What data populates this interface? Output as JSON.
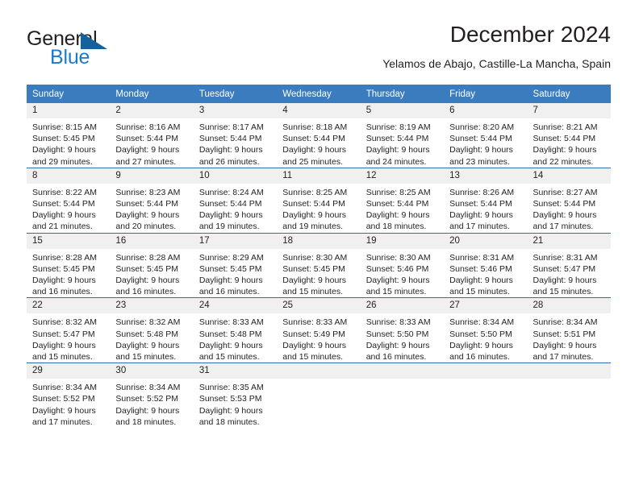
{
  "brand": {
    "line1": "General",
    "line2": "Blue",
    "flag_icon": "triangle-flag-icon",
    "blue_hex": "#1c7ac9",
    "dark_hex": "#15619e"
  },
  "header": {
    "title": "December 2024",
    "subtitle": "Yelamos de Abajo, Castille-La Mancha, Spain"
  },
  "theme": {
    "header_row_bg": "#3a7cbe",
    "daynum_bg": "#f0f0f0",
    "row_divider": "#2c6fb0"
  },
  "weekday_headers": [
    "Sunday",
    "Monday",
    "Tuesday",
    "Wednesday",
    "Thursday",
    "Friday",
    "Saturday"
  ],
  "weeks": [
    [
      {
        "day": "1",
        "sunrise": "Sunrise: 8:15 AM",
        "sunset": "Sunset: 5:45 PM",
        "daylight1": "Daylight: 9 hours",
        "daylight2": "and 29 minutes."
      },
      {
        "day": "2",
        "sunrise": "Sunrise: 8:16 AM",
        "sunset": "Sunset: 5:44 PM",
        "daylight1": "Daylight: 9 hours",
        "daylight2": "and 27 minutes."
      },
      {
        "day": "3",
        "sunrise": "Sunrise: 8:17 AM",
        "sunset": "Sunset: 5:44 PM",
        "daylight1": "Daylight: 9 hours",
        "daylight2": "and 26 minutes."
      },
      {
        "day": "4",
        "sunrise": "Sunrise: 8:18 AM",
        "sunset": "Sunset: 5:44 PM",
        "daylight1": "Daylight: 9 hours",
        "daylight2": "and 25 minutes."
      },
      {
        "day": "5",
        "sunrise": "Sunrise: 8:19 AM",
        "sunset": "Sunset: 5:44 PM",
        "daylight1": "Daylight: 9 hours",
        "daylight2": "and 24 minutes."
      },
      {
        "day": "6",
        "sunrise": "Sunrise: 8:20 AM",
        "sunset": "Sunset: 5:44 PM",
        "daylight1": "Daylight: 9 hours",
        "daylight2": "and 23 minutes."
      },
      {
        "day": "7",
        "sunrise": "Sunrise: 8:21 AM",
        "sunset": "Sunset: 5:44 PM",
        "daylight1": "Daylight: 9 hours",
        "daylight2": "and 22 minutes."
      }
    ],
    [
      {
        "day": "8",
        "sunrise": "Sunrise: 8:22 AM",
        "sunset": "Sunset: 5:44 PM",
        "daylight1": "Daylight: 9 hours",
        "daylight2": "and 21 minutes."
      },
      {
        "day": "9",
        "sunrise": "Sunrise: 8:23 AM",
        "sunset": "Sunset: 5:44 PM",
        "daylight1": "Daylight: 9 hours",
        "daylight2": "and 20 minutes."
      },
      {
        "day": "10",
        "sunrise": "Sunrise: 8:24 AM",
        "sunset": "Sunset: 5:44 PM",
        "daylight1": "Daylight: 9 hours",
        "daylight2": "and 19 minutes."
      },
      {
        "day": "11",
        "sunrise": "Sunrise: 8:25 AM",
        "sunset": "Sunset: 5:44 PM",
        "daylight1": "Daylight: 9 hours",
        "daylight2": "and 19 minutes."
      },
      {
        "day": "12",
        "sunrise": "Sunrise: 8:25 AM",
        "sunset": "Sunset: 5:44 PM",
        "daylight1": "Daylight: 9 hours",
        "daylight2": "and 18 minutes."
      },
      {
        "day": "13",
        "sunrise": "Sunrise: 8:26 AM",
        "sunset": "Sunset: 5:44 PM",
        "daylight1": "Daylight: 9 hours",
        "daylight2": "and 17 minutes."
      },
      {
        "day": "14",
        "sunrise": "Sunrise: 8:27 AM",
        "sunset": "Sunset: 5:44 PM",
        "daylight1": "Daylight: 9 hours",
        "daylight2": "and 17 minutes."
      }
    ],
    [
      {
        "day": "15",
        "sunrise": "Sunrise: 8:28 AM",
        "sunset": "Sunset: 5:45 PM",
        "daylight1": "Daylight: 9 hours",
        "daylight2": "and 16 minutes."
      },
      {
        "day": "16",
        "sunrise": "Sunrise: 8:28 AM",
        "sunset": "Sunset: 5:45 PM",
        "daylight1": "Daylight: 9 hours",
        "daylight2": "and 16 minutes."
      },
      {
        "day": "17",
        "sunrise": "Sunrise: 8:29 AM",
        "sunset": "Sunset: 5:45 PM",
        "daylight1": "Daylight: 9 hours",
        "daylight2": "and 16 minutes."
      },
      {
        "day": "18",
        "sunrise": "Sunrise: 8:30 AM",
        "sunset": "Sunset: 5:45 PM",
        "daylight1": "Daylight: 9 hours",
        "daylight2": "and 15 minutes."
      },
      {
        "day": "19",
        "sunrise": "Sunrise: 8:30 AM",
        "sunset": "Sunset: 5:46 PM",
        "daylight1": "Daylight: 9 hours",
        "daylight2": "and 15 minutes."
      },
      {
        "day": "20",
        "sunrise": "Sunrise: 8:31 AM",
        "sunset": "Sunset: 5:46 PM",
        "daylight1": "Daylight: 9 hours",
        "daylight2": "and 15 minutes."
      },
      {
        "day": "21",
        "sunrise": "Sunrise: 8:31 AM",
        "sunset": "Sunset: 5:47 PM",
        "daylight1": "Daylight: 9 hours",
        "daylight2": "and 15 minutes."
      }
    ],
    [
      {
        "day": "22",
        "sunrise": "Sunrise: 8:32 AM",
        "sunset": "Sunset: 5:47 PM",
        "daylight1": "Daylight: 9 hours",
        "daylight2": "and 15 minutes."
      },
      {
        "day": "23",
        "sunrise": "Sunrise: 8:32 AM",
        "sunset": "Sunset: 5:48 PM",
        "daylight1": "Daylight: 9 hours",
        "daylight2": "and 15 minutes."
      },
      {
        "day": "24",
        "sunrise": "Sunrise: 8:33 AM",
        "sunset": "Sunset: 5:48 PM",
        "daylight1": "Daylight: 9 hours",
        "daylight2": "and 15 minutes."
      },
      {
        "day": "25",
        "sunrise": "Sunrise: 8:33 AM",
        "sunset": "Sunset: 5:49 PM",
        "daylight1": "Daylight: 9 hours",
        "daylight2": "and 15 minutes."
      },
      {
        "day": "26",
        "sunrise": "Sunrise: 8:33 AM",
        "sunset": "Sunset: 5:50 PM",
        "daylight1": "Daylight: 9 hours",
        "daylight2": "and 16 minutes."
      },
      {
        "day": "27",
        "sunrise": "Sunrise: 8:34 AM",
        "sunset": "Sunset: 5:50 PM",
        "daylight1": "Daylight: 9 hours",
        "daylight2": "and 16 minutes."
      },
      {
        "day": "28",
        "sunrise": "Sunrise: 8:34 AM",
        "sunset": "Sunset: 5:51 PM",
        "daylight1": "Daylight: 9 hours",
        "daylight2": "and 17 minutes."
      }
    ],
    [
      {
        "day": "29",
        "sunrise": "Sunrise: 8:34 AM",
        "sunset": "Sunset: 5:52 PM",
        "daylight1": "Daylight: 9 hours",
        "daylight2": "and 17 minutes."
      },
      {
        "day": "30",
        "sunrise": "Sunrise: 8:34 AM",
        "sunset": "Sunset: 5:52 PM",
        "daylight1": "Daylight: 9 hours",
        "daylight2": "and 18 minutes."
      },
      {
        "day": "31",
        "sunrise": "Sunrise: 8:35 AM",
        "sunset": "Sunset: 5:53 PM",
        "daylight1": "Daylight: 9 hours",
        "daylight2": "and 18 minutes."
      },
      {
        "day": "",
        "sunrise": "",
        "sunset": "",
        "daylight1": "",
        "daylight2": ""
      },
      {
        "day": "",
        "sunrise": "",
        "sunset": "",
        "daylight1": "",
        "daylight2": ""
      },
      {
        "day": "",
        "sunrise": "",
        "sunset": "",
        "daylight1": "",
        "daylight2": ""
      },
      {
        "day": "",
        "sunrise": "",
        "sunset": "",
        "daylight1": "",
        "daylight2": ""
      }
    ]
  ]
}
